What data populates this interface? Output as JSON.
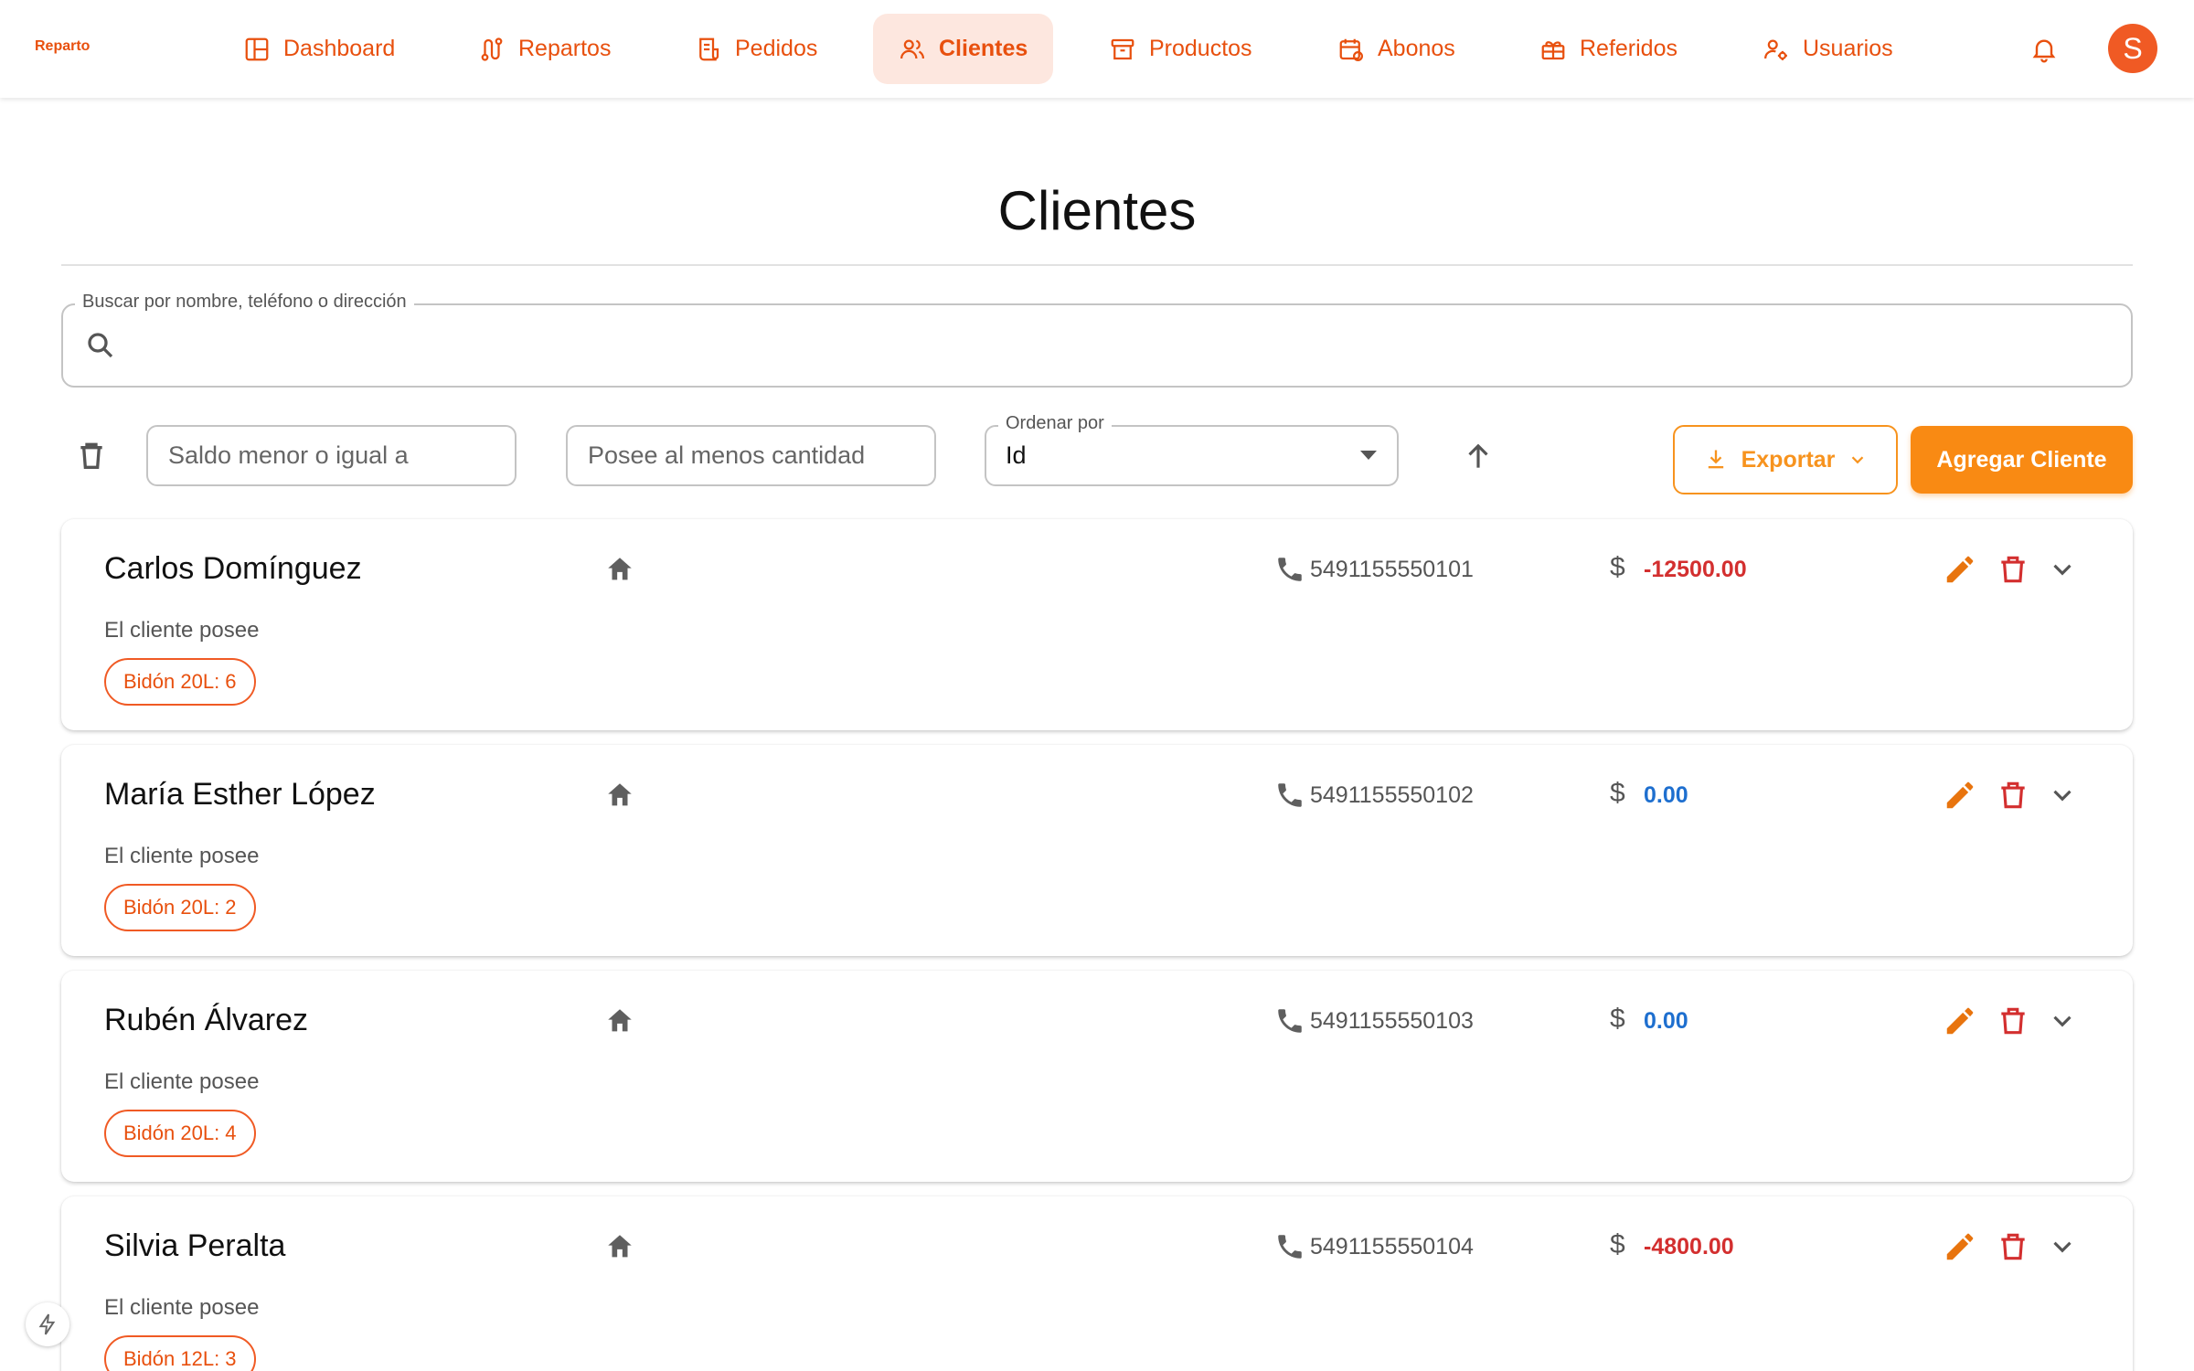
{
  "app": {
    "brand": "Reparto"
  },
  "nav": {
    "items": [
      {
        "label": "Dashboard",
        "icon": "dashboard-icon",
        "active": false
      },
      {
        "label": "Repartos",
        "icon": "route-icon",
        "active": false
      },
      {
        "label": "Pedidos",
        "icon": "receipt-icon",
        "active": false
      },
      {
        "label": "Clientes",
        "icon": "users-icon",
        "active": true
      },
      {
        "label": "Productos",
        "icon": "archive-icon",
        "active": false
      },
      {
        "label": "Abonos",
        "icon": "calendar-icon",
        "active": false
      },
      {
        "label": "Referidos",
        "icon": "gift-icon",
        "active": false
      },
      {
        "label": "Usuarios",
        "icon": "user-settings-icon",
        "active": false
      }
    ],
    "avatar_initial": "S"
  },
  "page": {
    "title": "Clientes"
  },
  "search": {
    "label": "Buscar por nombre, teléfono o dirección",
    "value": ""
  },
  "filters": {
    "saldo_placeholder": "Saldo menor o igual a",
    "cantidad_placeholder": "Posee al menos cantidad",
    "order_label": "Ordenar por",
    "order_value": "Id",
    "export_label": "Exportar",
    "add_label": "Agregar Cliente"
  },
  "colors": {
    "accent": "#e8500e",
    "orange_button": "#f98a13",
    "negative": "#d32f2f",
    "zero": "#1e6fcf"
  },
  "clients": [
    {
      "name": "Carlos Domínguez",
      "phone": "5491155550101",
      "currency": "$",
      "balance": "-12500.00",
      "balance_state": "negative",
      "owns_label": "El cliente posee",
      "chip": "Bidón 20L: 6"
    },
    {
      "name": "María Esther López",
      "phone": "5491155550102",
      "currency": "$",
      "balance": "0.00",
      "balance_state": "zero",
      "owns_label": "El cliente posee",
      "chip": "Bidón 20L: 2"
    },
    {
      "name": "Rubén Álvarez",
      "phone": "5491155550103",
      "currency": "$",
      "balance": "0.00",
      "balance_state": "zero",
      "owns_label": "El cliente posee",
      "chip": "Bidón 20L: 4"
    },
    {
      "name": "Silvia Peralta",
      "phone": "5491155550104",
      "currency": "$",
      "balance": "-4800.00",
      "balance_state": "negative",
      "owns_label": "El cliente posee",
      "chip": "Bidón 12L: 3"
    }
  ]
}
